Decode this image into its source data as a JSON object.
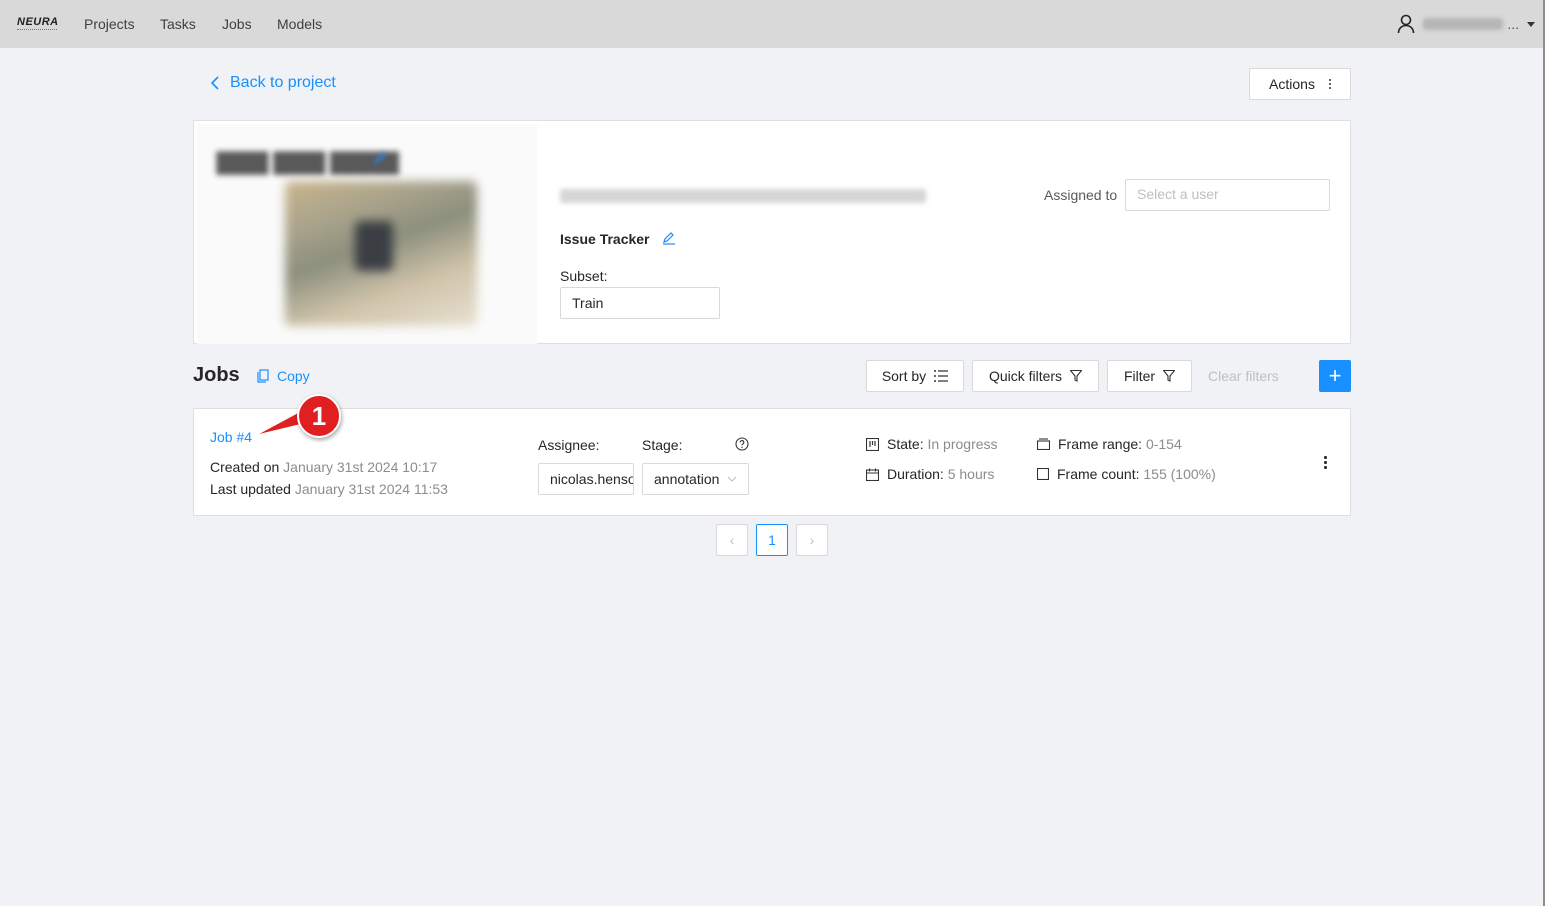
{
  "header": {
    "logo": "NEURA",
    "nav": [
      "Projects",
      "Tasks",
      "Jobs",
      "Models"
    ],
    "user_ellipsis": "..."
  },
  "back_link": "Back to project",
  "actions_label": "Actions",
  "task": {
    "assigned_label": "Assigned to",
    "assigned_placeholder": "Select a user",
    "issue_tracker_label": "Issue Tracker",
    "subset_label": "Subset:",
    "subset_value": "Train"
  },
  "jobs": {
    "title": "Jobs",
    "copy_label": "Copy",
    "sort_label": "Sort by",
    "quick_filters_label": "Quick filters",
    "filter_label": "Filter",
    "clear_filters_label": "Clear filters",
    "add_label": "+"
  },
  "job": {
    "link": "Job #4",
    "created_label": "Created on",
    "created_value": "January 31st 2024 10:17",
    "updated_label": "Last updated",
    "updated_value": "January 31st 2024 11:53",
    "assignee_label": "Assignee:",
    "assignee_value": "nicolas.henson",
    "stage_label": "Stage:",
    "stage_value": "annotation",
    "state_label": "State:",
    "state_value": "In progress",
    "duration_label": "Duration:",
    "duration_value": "5 hours",
    "frame_range_label": "Frame range:",
    "frame_range_value": "0-154",
    "frame_count_label": "Frame count:",
    "frame_count_value": "155 (100%)"
  },
  "annotation_badge": "1",
  "pagination": {
    "prev": "‹",
    "current": "1",
    "next": "›"
  },
  "colors": {
    "accent": "#1890ff",
    "badge": "#e02020",
    "topbar": "#d9d9d9",
    "background": "#f0f2f5"
  }
}
